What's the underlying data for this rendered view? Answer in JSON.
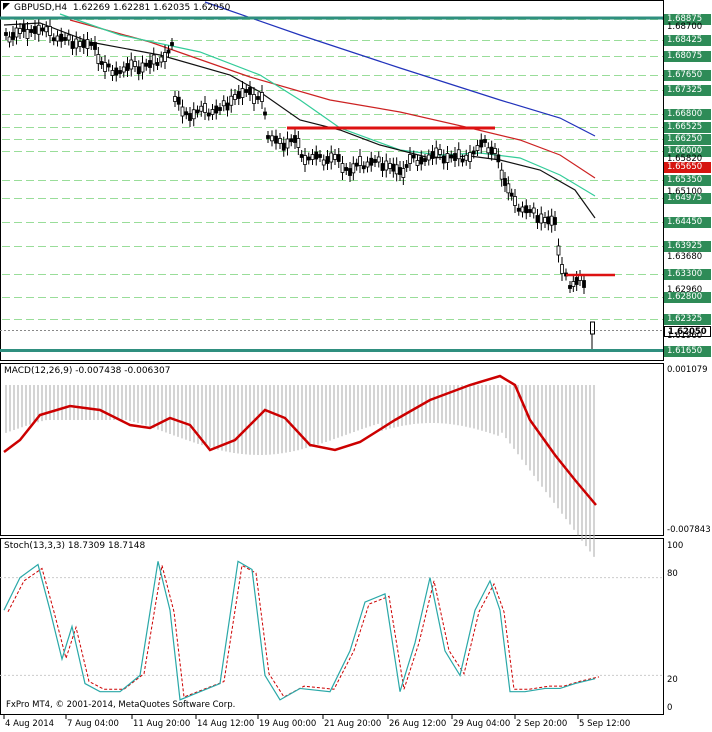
{
  "main": {
    "title": "GBPUSD,H4  1.62269 1.62281 1.62035 1.62050",
    "price_axis": [
      "1.68700",
      "1.65820",
      "1.65100",
      "1.63680",
      "1.62960",
      "1.61960"
    ],
    "green_level_tags": [
      "1.68875",
      "1.68425",
      "1.68075",
      "1.67650",
      "1.67325",
      "1.66800",
      "1.66525",
      "1.66250",
      "1.66000",
      "1.65350",
      "1.64975",
      "1.64450",
      "1.63925",
      "1.63300",
      "1.62800",
      "1.62325"
    ],
    "red_tags": [
      "1.65650"
    ],
    "current_price": "1.62050",
    "support_tag": "1.61650",
    "colors": {
      "support_line": "#2f8f7f",
      "red_line": "#dd1111",
      "ma_blue": "#2233bb",
      "ma_red": "#cc2222",
      "ma_green": "#33cc99",
      "ma_black": "#111111",
      "grid": "#99dd99"
    }
  },
  "macd": {
    "title": "MACD(12,26,9) -0.007438 -0.006307",
    "axis": [
      "0.001079",
      "-0.007843"
    ]
  },
  "stoch": {
    "title": "Stoch(13,3,3) 18.7309 18.7148",
    "axis": [
      "100",
      "80",
      "20",
      "0"
    ]
  },
  "time_axis": [
    "4 Aug 2014",
    "7 Aug 04:00",
    "11 Aug 20:00",
    "14 Aug 12:00",
    "19 Aug 00:00",
    "21 Aug 20:00",
    "26 Aug 12:00",
    "29 Aug 04:00",
    "2 Sep 20:00",
    "5 Sep 12:00"
  ],
  "copyright": "FxPro MT4,  © 2001-2014, MetaQuotes Software Corp."
}
